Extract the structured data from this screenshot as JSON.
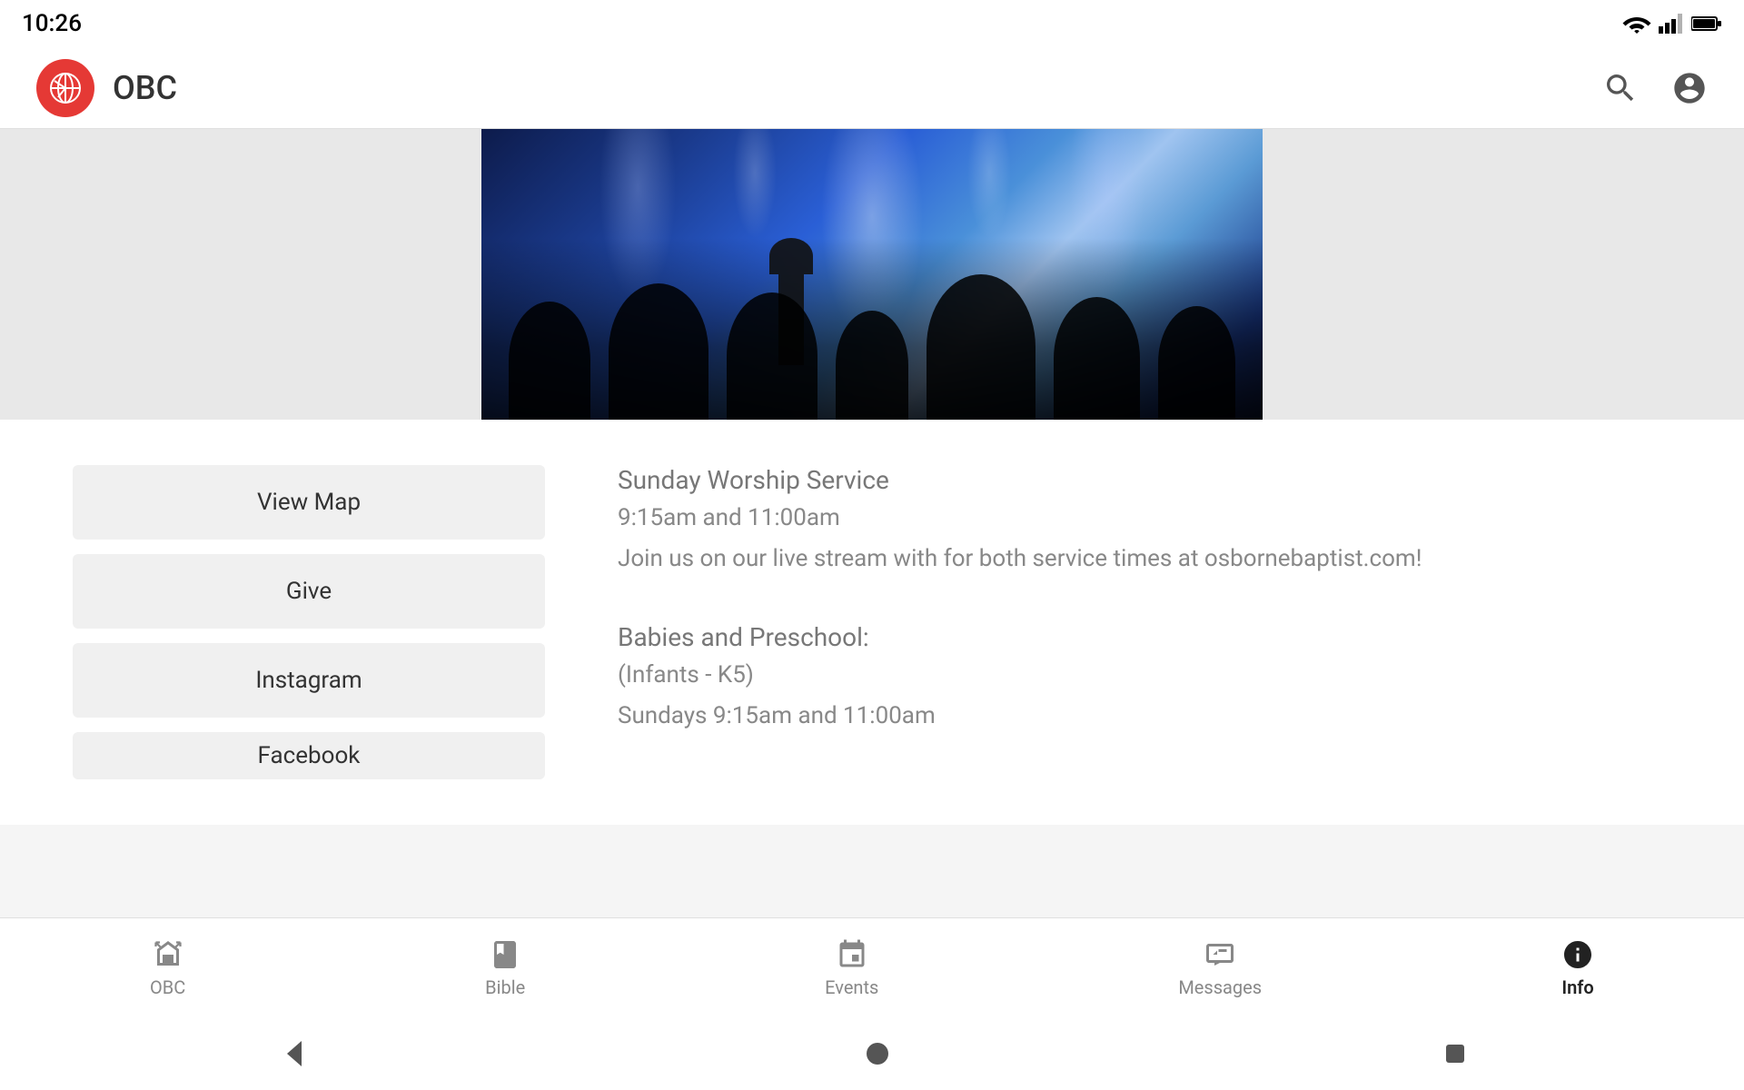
{
  "status": {
    "time": "10:26"
  },
  "app": {
    "title": "OBC"
  },
  "hero": {
    "alt": "Worship service with crowd and stage lights"
  },
  "buttons": [
    {
      "label": "View Map"
    },
    {
      "label": "Give"
    },
    {
      "label": "Instagram"
    },
    {
      "label": "Facebook"
    }
  ],
  "info_blocks": [
    {
      "title": "Sunday Worship Service",
      "lines": [
        "9:15am and 11:00am",
        "Join us on our live stream with for both service times at osbornebaptist.com!"
      ]
    },
    {
      "title": "Babies and Preschool:",
      "lines": [
        "(Infants - K5)",
        "Sundays 9:15am and 11:00am"
      ]
    }
  ],
  "nav": {
    "items": [
      {
        "label": "OBC",
        "icon": "obc-icon",
        "active": false
      },
      {
        "label": "Bible",
        "icon": "bible-icon",
        "active": false
      },
      {
        "label": "Events",
        "icon": "events-icon",
        "active": false
      },
      {
        "label": "Messages",
        "icon": "messages-icon",
        "active": false
      },
      {
        "label": "Info",
        "icon": "info-icon",
        "active": true
      }
    ]
  },
  "colors": {
    "accent": "#e53935",
    "nav_active": "#222222",
    "nav_inactive": "#888888"
  }
}
